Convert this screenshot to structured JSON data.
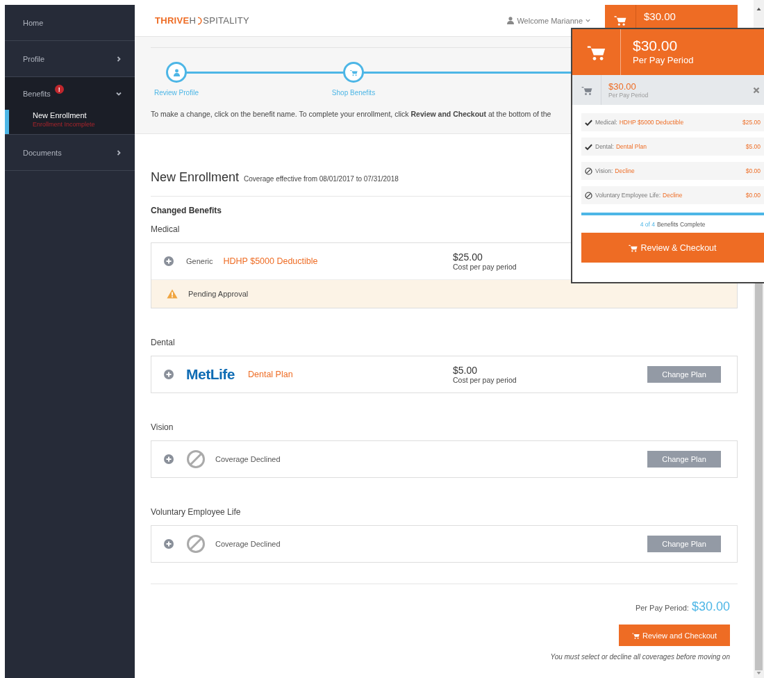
{
  "sidebar": {
    "items": [
      {
        "kind": "link",
        "label": "Home"
      },
      {
        "kind": "group",
        "label": "Profile",
        "expanded": false
      },
      {
        "kind": "group",
        "label": "Benefits",
        "expanded": true,
        "alert": "!",
        "children": [
          {
            "label": "New Enrollment",
            "status": "Enrollment Incomplete",
            "selected": true
          }
        ]
      },
      {
        "kind": "group",
        "label": "Documents",
        "expanded": false
      }
    ]
  },
  "header": {
    "logo": {
      "accent": "THRIVE",
      "before_ring": "H",
      "after_ring": "SPITALITY"
    },
    "user_menu": "Welcome Marianne",
    "cart": {
      "amount": "$30.00"
    }
  },
  "stepper": {
    "steps": [
      {
        "kind": "profile",
        "label": "Review Profile"
      },
      {
        "kind": "shop",
        "label": "Shop Benefits"
      }
    ],
    "instruction": "To make a change, click on the benefit name. To complete your enrollment, click **Review and Checkout** at the bottom of the"
  },
  "enrollment": {
    "title": "New Enrollment",
    "coverage": "Coverage effective from 08/01/2017 to 07/31/2018",
    "subtitle": "Changed Benefits",
    "sections": [
      {
        "title": "Medical",
        "kind": "plan",
        "carrier": {
          "kind": "text",
          "name": "Generic"
        },
        "plan": "HDHP $5000 Deductible",
        "cost": "$25.00",
        "cost_label": "Cost per pay period",
        "alert": "Pending Approval"
      },
      {
        "title": "Dental",
        "kind": "plan",
        "carrier": {
          "kind": "logo",
          "name": "MetLife"
        },
        "plan": "Dental Plan",
        "cost": "$5.00",
        "cost_label": "Cost per pay period",
        "button": "Change Plan"
      },
      {
        "title": "Vision",
        "kind": "declined",
        "status": "Coverage Declined",
        "button": "Change Plan"
      },
      {
        "title": "Voluntary Employee Life",
        "kind": "declined",
        "status": "Coverage Declined",
        "button": "Change Plan"
      }
    ]
  },
  "footer": {
    "total_label": "Per Pay Period:",
    "total": "$30.00",
    "button": "Review and Checkout",
    "note": "You must select or decline all coverages before moving on"
  },
  "cart_popup": {
    "amount": "$30.00",
    "caption": "Per Pay Period",
    "sub_amount": "$30.00",
    "sub_caption": "Per Pay Period",
    "items": [
      {
        "kind": "selected",
        "category": "Medical:",
        "plan": "HDHP $5000 Deductible",
        "price": "$25.00"
      },
      {
        "kind": "selected",
        "category": "Dental:",
        "plan": "Dental Plan",
        "price": "$5.00"
      },
      {
        "kind": "declined",
        "category": "Vision:",
        "plan": "Decline",
        "price": "$0.00"
      },
      {
        "kind": "declined",
        "category": "Voluntary Employee Life:",
        "plan": "Decline",
        "price": "$0.00"
      }
    ],
    "progress": {
      "level": 1,
      "count": "4 of 4",
      "label": "Benefits Complete"
    },
    "button": "Review & Checkout"
  }
}
